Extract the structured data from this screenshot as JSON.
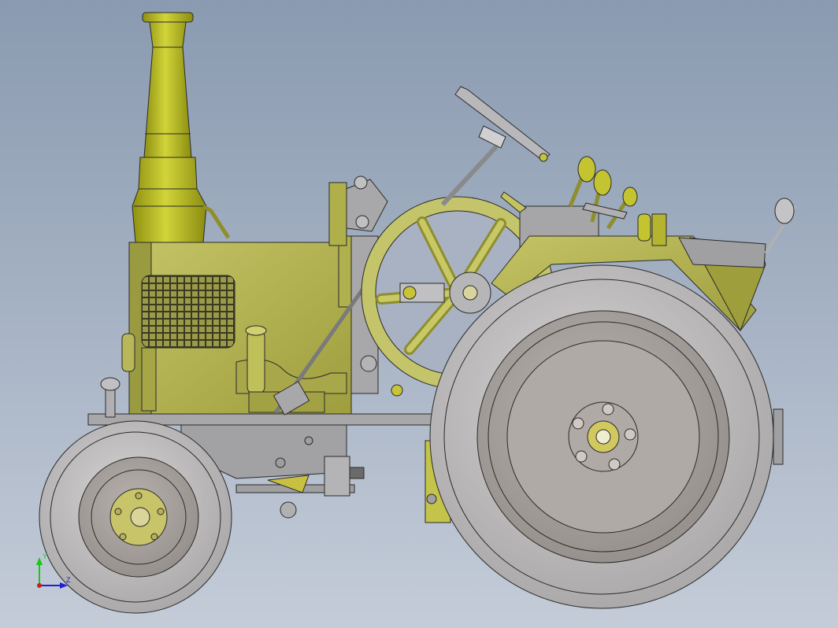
{
  "triad": {
    "y_label": "Y",
    "z_label": "Z",
    "y_color": "#19c619",
    "z_color": "#2020d8",
    "origin_color": "#c81e1e"
  },
  "colors": {
    "body": "#b3b34f",
    "body_dark": "#8e8e2c",
    "exhaust": "#b6b826",
    "tire": "#c2c0c0",
    "rim": "#aaa6a4",
    "metal": "#9e9ea0",
    "outline": "#2a2a2a"
  }
}
